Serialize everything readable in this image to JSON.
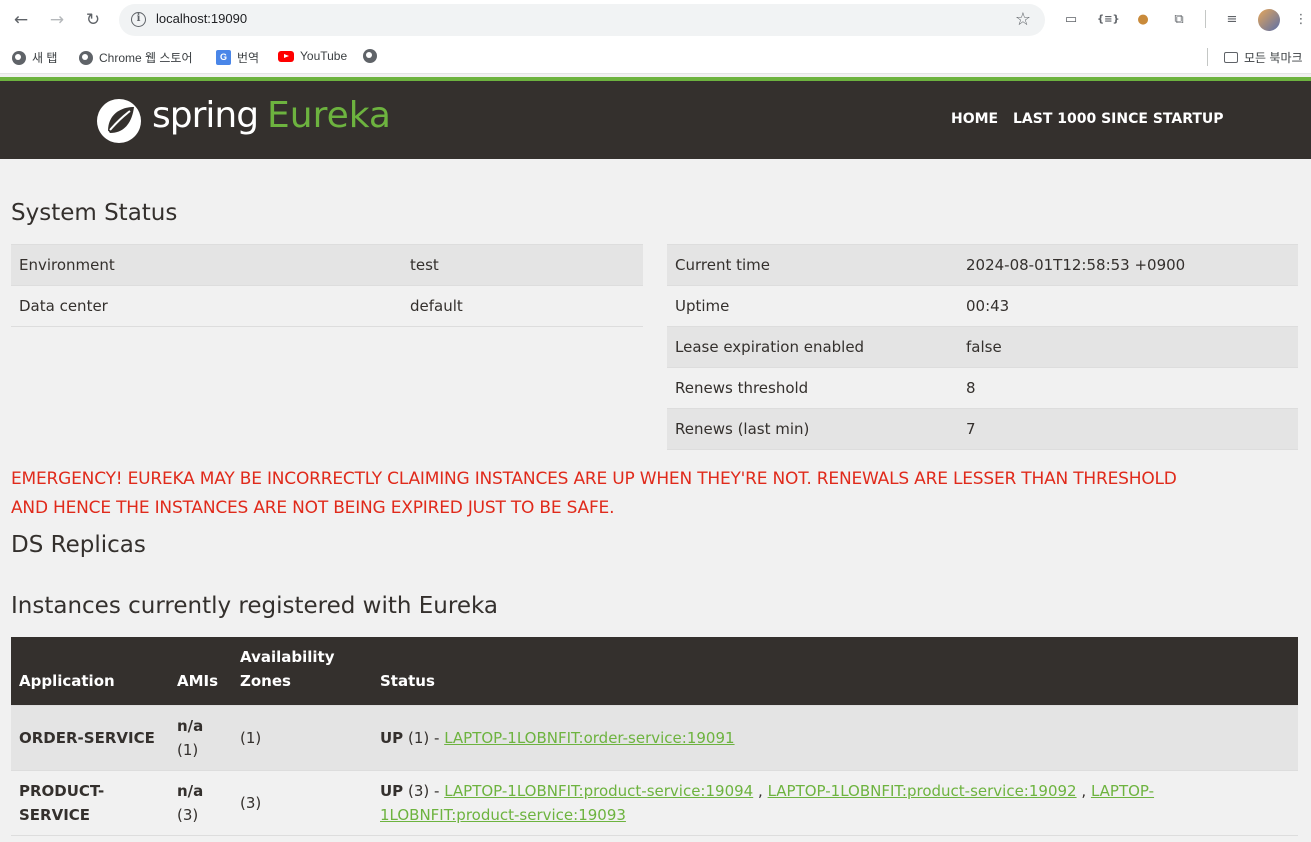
{
  "browser": {
    "url": "localhost:19090",
    "bookmarks": [
      {
        "label": "새 탭",
        "icon": "globe-icon"
      },
      {
        "label": "Chrome 웹 스토어",
        "icon": "globe-icon"
      },
      {
        "label": "번역",
        "icon": "translate-icon"
      },
      {
        "label": "YouTube",
        "icon": "youtube-icon"
      },
      {
        "label": "",
        "icon": "globe-icon"
      }
    ],
    "all_bookmarks": "모든 북마크"
  },
  "header": {
    "logo_spring": "spring",
    "logo_eureka": "Eureka",
    "nav": [
      {
        "label": "HOME"
      },
      {
        "label": "LAST 1000 SINCE STARTUP"
      }
    ]
  },
  "system_status": {
    "title": "System Status",
    "left": [
      {
        "key": "Environment",
        "value": "test"
      },
      {
        "key": "Data center",
        "value": "default"
      }
    ],
    "right": [
      {
        "key": "Current time",
        "value": "2024-08-01T12:58:53 +0900"
      },
      {
        "key": "Uptime",
        "value": "00:43"
      },
      {
        "key": "Lease expiration enabled",
        "value": "false"
      },
      {
        "key": "Renews threshold",
        "value": "8"
      },
      {
        "key": "Renews (last min)",
        "value": "7"
      }
    ]
  },
  "emergency": {
    "line1": "EMERGENCY! EUREKA MAY BE INCORRECTLY CLAIMING INSTANCES ARE UP WHEN THEY'RE NOT. RENEWALS ARE LESSER THAN THRESHOLD",
    "line2": "AND HENCE THE INSTANCES ARE NOT BEING EXPIRED JUST TO BE SAFE."
  },
  "ds_replicas": {
    "title": "DS Replicas"
  },
  "instances": {
    "title": "Instances currently registered with Eureka",
    "columns": [
      "Application",
      "AMIs",
      "Availability Zones",
      "Status"
    ],
    "rows": [
      {
        "application": "ORDER-SERVICE",
        "amis_line1": "n/a",
        "amis_line2": "(1)",
        "zones": "(1)",
        "status_state": "UP",
        "status_count": "(1) -",
        "links": [
          "LAPTOP-1LOBNFIT:order-service:19091"
        ]
      },
      {
        "application_line1": "PRODUCT-",
        "application_line2": "SERVICE",
        "amis_line1": "n/a",
        "amis_line2": "(3)",
        "zones": "(3)",
        "status_state": "UP",
        "status_count": "(3) -",
        "links": [
          "LAPTOP-1LOBNFIT:product-service:19094",
          "LAPTOP-1LOBNFIT:product-service:19092",
          "LAPTOP-",
          "1LOBNFIT:product-service:19093"
        ],
        "separator": ","
      }
    ]
  }
}
